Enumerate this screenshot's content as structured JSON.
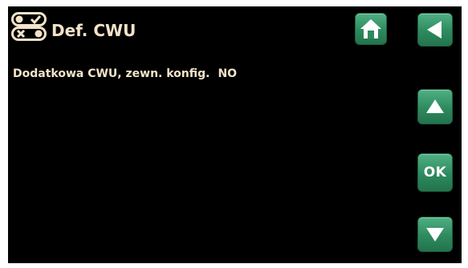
{
  "header": {
    "title": "Def. CWU",
    "icon": "toggle-settings-icon"
  },
  "setting": {
    "label": "Dodatkowa CWU, zewn. konfig.",
    "value": "NO"
  },
  "nav": {
    "home_icon": "home-icon",
    "back_icon": "back-arrow-icon",
    "up_icon": "up-arrow-icon",
    "ok_label": "OK",
    "down_icon": "down-arrow-icon"
  },
  "colors": {
    "background": "#000000",
    "text": "#f2e3c8",
    "button_green": "#2e8a5e"
  }
}
